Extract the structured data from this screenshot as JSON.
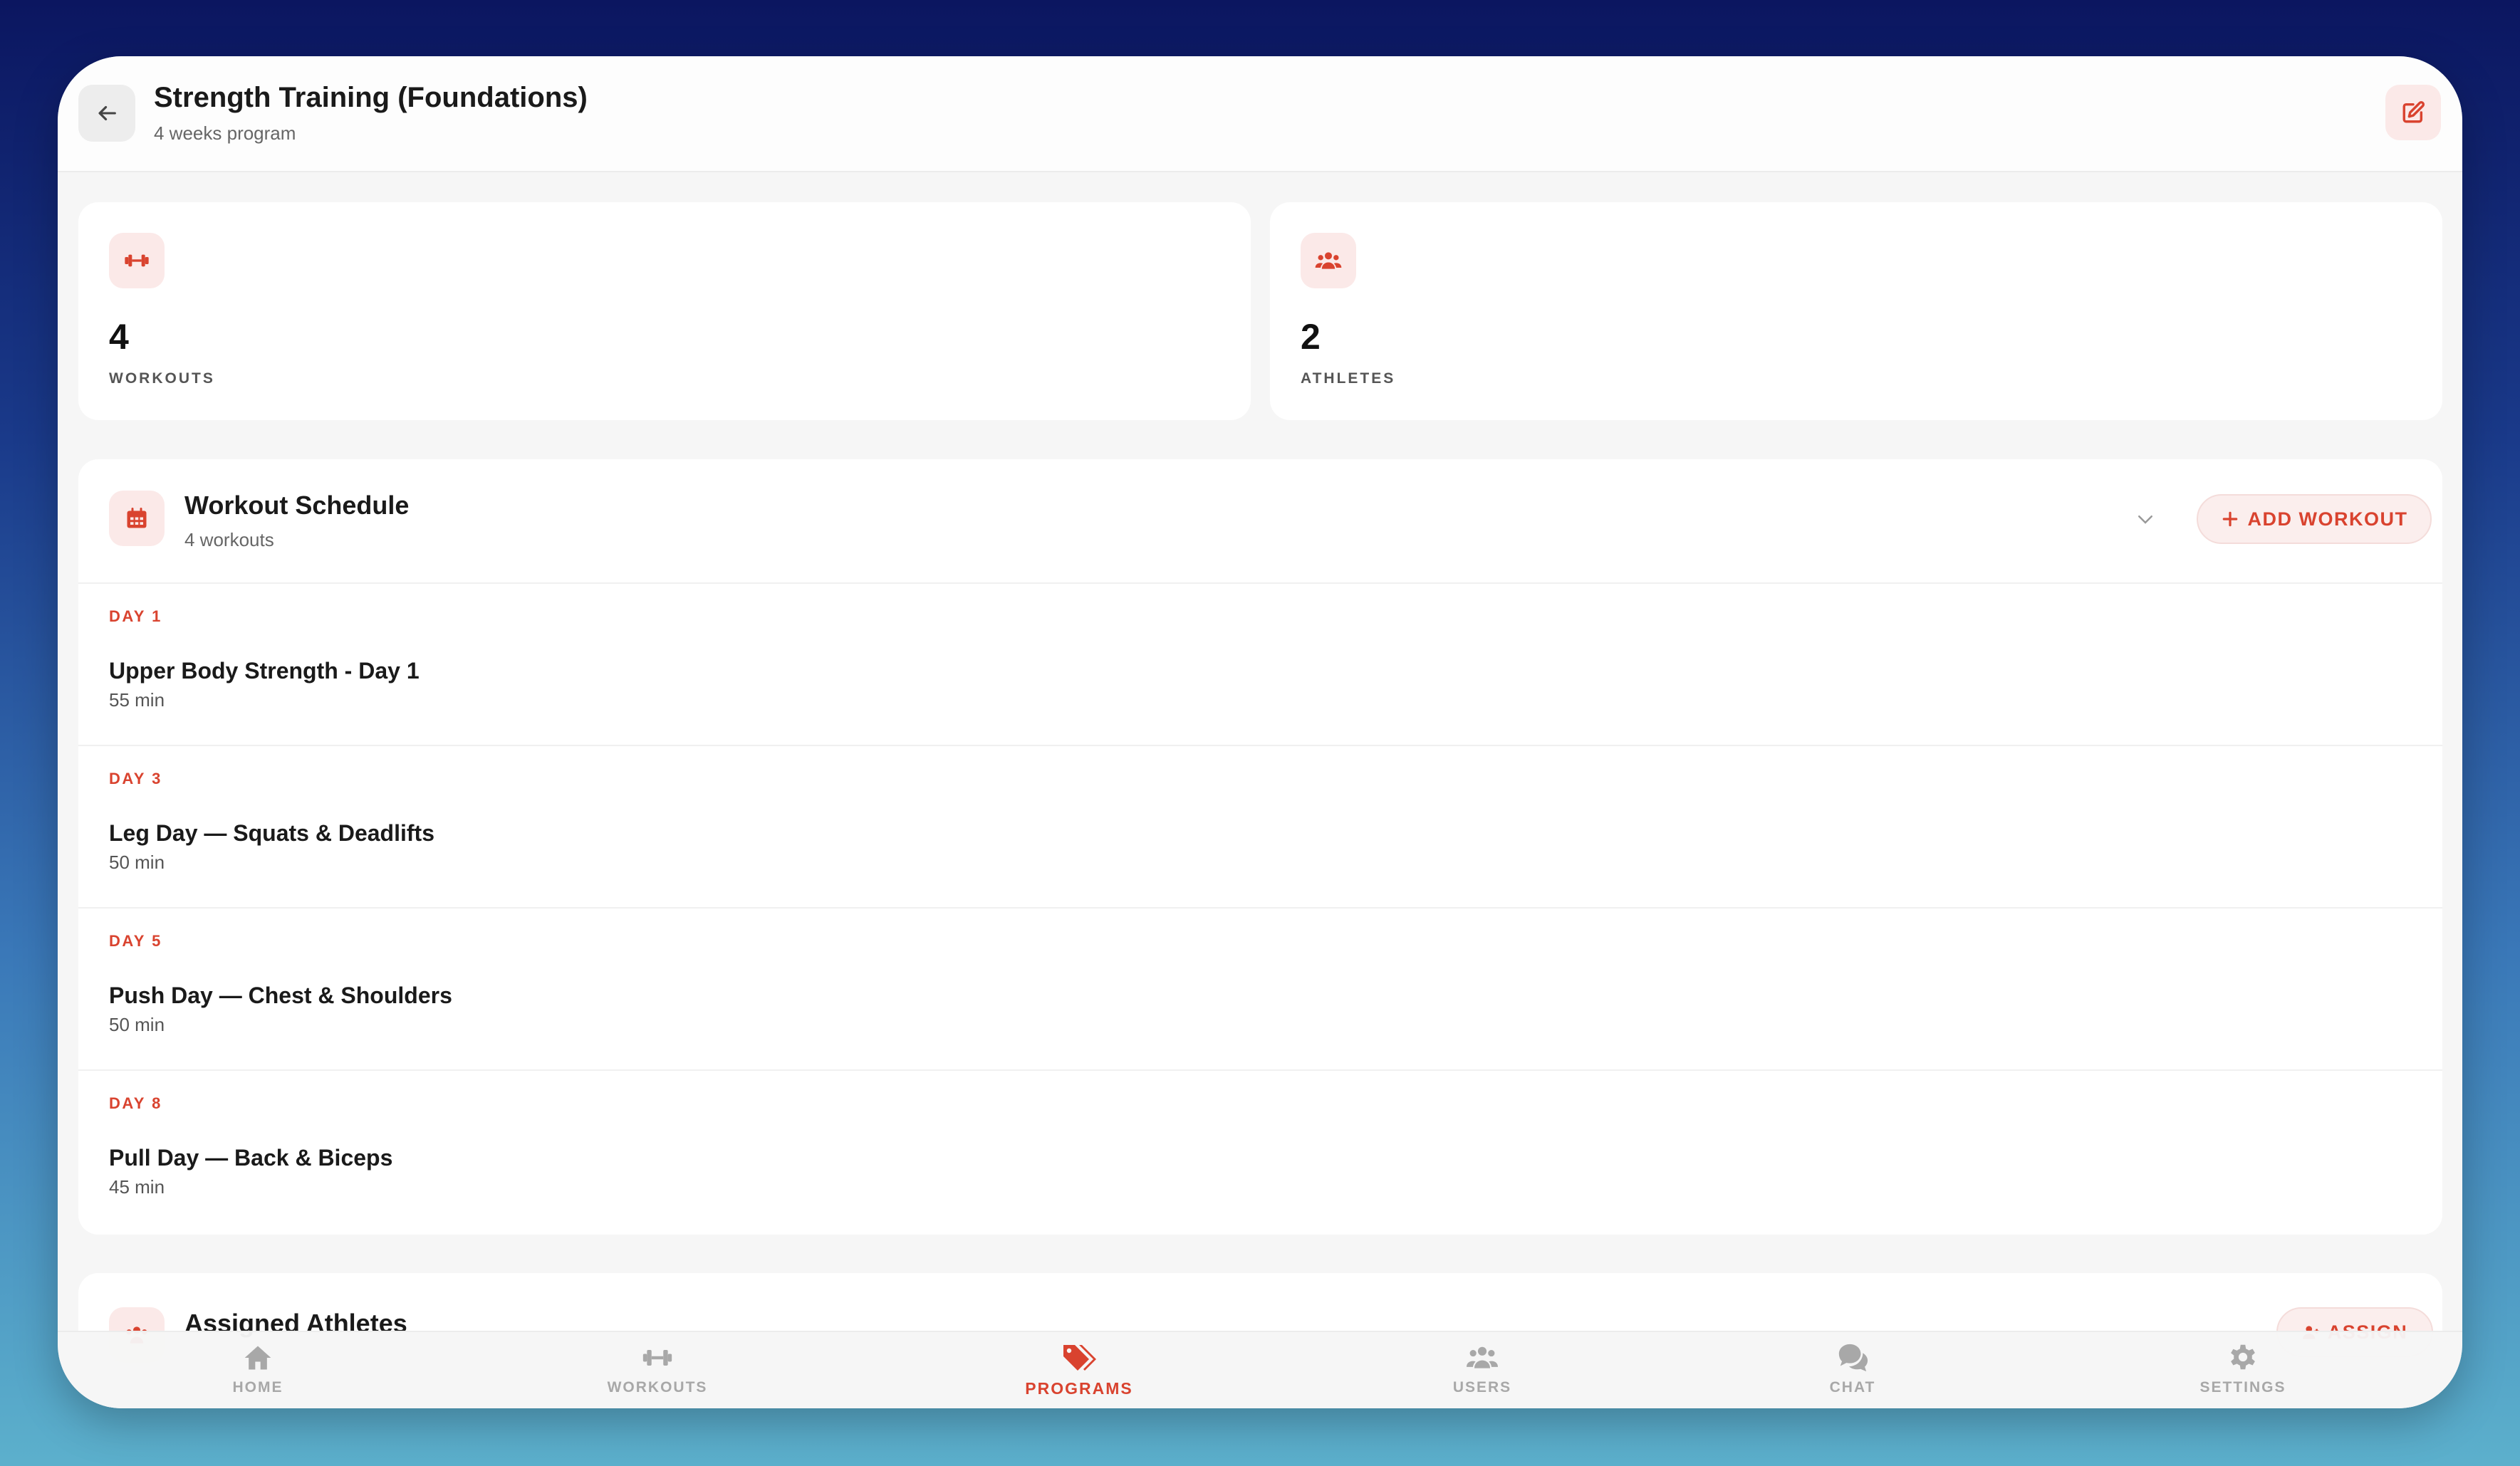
{
  "header": {
    "title": "Strength Training (Foundations)",
    "subtitle": "4 weeks program"
  },
  "stats": [
    {
      "value": "4",
      "label": "WORKOUTS",
      "icon": "dumbbell-icon"
    },
    {
      "value": "2",
      "label": "ATHLETES",
      "icon": "users-icon"
    }
  ],
  "schedule": {
    "title": "Workout Schedule",
    "subtitle": "4 workouts",
    "add_label": "ADD WORKOUT",
    "days": [
      {
        "day": "DAY 1",
        "name": "Upper Body Strength - Day 1",
        "duration": "55 min"
      },
      {
        "day": "DAY 3",
        "name": "Leg Day — Squats & Deadlifts",
        "duration": "50 min"
      },
      {
        "day": "DAY 5",
        "name": "Push Day — Chest & Shoulders",
        "duration": "50 min"
      },
      {
        "day": "DAY 8",
        "name": "Pull Day — Back & Biceps",
        "duration": "45 min"
      }
    ]
  },
  "athletes": {
    "title": "Assigned Athletes",
    "assign_label": "ASSIGN"
  },
  "tabs": [
    {
      "label": "HOME",
      "icon": "home-icon"
    },
    {
      "label": "WORKOUTS",
      "icon": "dumbbell-icon"
    },
    {
      "label": "PROGRAMS",
      "icon": "tags-icon"
    },
    {
      "label": "USERS",
      "icon": "users-icon"
    },
    {
      "label": "CHAT",
      "icon": "chat-icon"
    },
    {
      "label": "SETTINGS",
      "icon": "gear-icon"
    }
  ],
  "colors": {
    "accent": "#d9432f",
    "accent_soft": "#fbe9e8",
    "inactive": "#a8a8a8"
  }
}
